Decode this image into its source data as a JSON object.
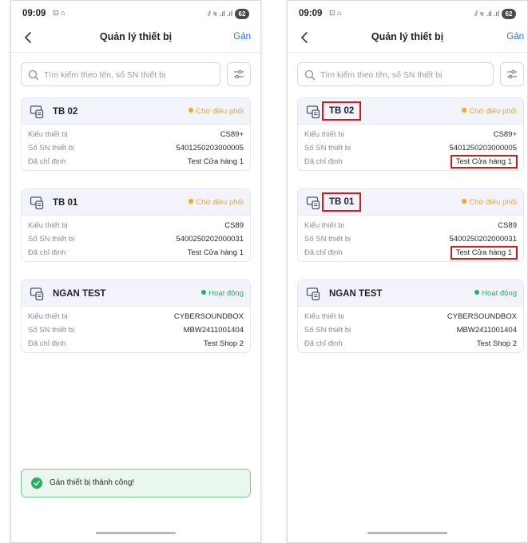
{
  "colors": {
    "accent": "#2f6fed",
    "pending": "#f5a623",
    "active": "#27ae60",
    "highlight": "#d31b1b",
    "toast_bg": "#eaf7ef",
    "toast_border": "#79cc98"
  },
  "left": {
    "status_bar": {
      "time": "09:09",
      "icons": "⊡ ⌂",
      "signal": "⫽ ≋ .ıl .ıl",
      "battery": "62"
    },
    "header": {
      "title": "Quản lý thiết bị",
      "action": "Gán"
    },
    "search": {
      "placeholder": "Tìm kiếm theo tên, số SN thiết bị"
    },
    "devices": [
      {
        "name": "TB 02",
        "status": "Chờ điều phối",
        "type_label": "Kiểu thiết bị",
        "type": "CS89+",
        "sn_label": "Số SN thiết bị",
        "sn": "5401250203000005",
        "assigned_label": "Đã chỉ định",
        "assigned": "Test Cửa hàng 1"
      },
      {
        "name": "TB 01",
        "status": "Chờ điều phối",
        "type_label": "Kiểu thiết bị",
        "type": "CS89",
        "sn_label": "Số SN thiết bị",
        "sn": "5400250202000031",
        "assigned_label": "Đã chỉ định",
        "assigned": "Test Cửa hàng 1"
      },
      {
        "name": "NGAN TEST",
        "status": "Hoạt động",
        "type_label": "Kiểu thiết bị",
        "type": "CYBERSOUNDBOX",
        "sn_label": "Số SN thiết bị",
        "sn": "MBW2411001404",
        "assigned_label": "Đã chỉ định",
        "assigned": "Test Shop 2"
      }
    ],
    "toast": {
      "text": "Gán thiết bị thành công!"
    }
  },
  "right": {
    "status_bar": {
      "time": "09:09",
      "icons": "⊡ ⌂",
      "signal": "⫽ ≋ .ıl .ıl",
      "battery": "62"
    },
    "header": {
      "title": "Quản lý thiết bị",
      "action": "Gán"
    },
    "search": {
      "placeholder": "Tìm kiếm theo tên, số SN thiết bị"
    },
    "devices": [
      {
        "name": "TB 02",
        "status": "Chờ điều phối",
        "type_label": "Kiểu thiết bị",
        "type": "CS89+",
        "sn_label": "Số SN thiết bị",
        "sn": "5401250203000005",
        "assigned_label": "Đã chỉ định",
        "assigned": "Test Cửa hàng 1"
      },
      {
        "name": "TB 01",
        "status": "Chờ điều phối",
        "type_label": "Kiểu thiết bị",
        "type": "CS89",
        "sn_label": "Số SN thiết bị",
        "sn": "5400250202000031",
        "assigned_label": "Đã chỉ định",
        "assigned": "Test Cửa hàng 1"
      },
      {
        "name": "NGAN TEST",
        "status": "Hoạt động",
        "type_label": "Kiểu thiết bị",
        "type": "CYBERSOUNDBOX",
        "sn_label": "Số SN thiết bị",
        "sn": "MBW2411001404",
        "assigned_label": "Đã chỉ định",
        "assigned": "Test Shop 2"
      }
    ]
  }
}
